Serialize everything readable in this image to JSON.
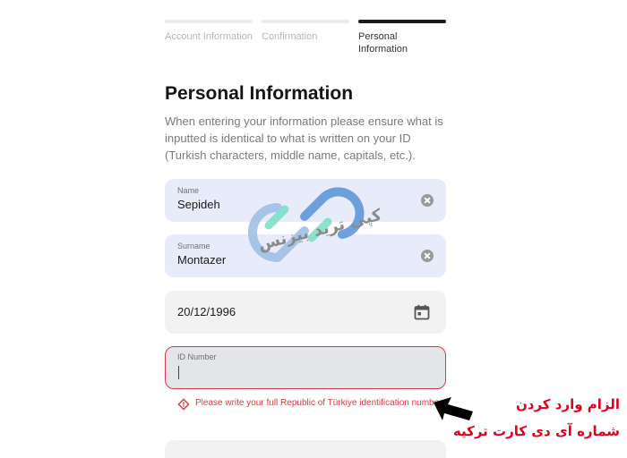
{
  "steps": [
    {
      "label": "Account Information",
      "active": false
    },
    {
      "label": "Confirmation",
      "active": false
    },
    {
      "label": "Personal Information",
      "active": true
    }
  ],
  "form": {
    "title": "Personal Information",
    "description": "When entering your information please ensure what is inputted is identical to what is written on your ID (Turkish characters, middle name, capitals, etc.).",
    "name": {
      "label": "Name",
      "value": "Sepideh"
    },
    "surname": {
      "label": "Surname",
      "value": "Montazer"
    },
    "birth_date": {
      "value": "20/12/1996"
    },
    "id_number": {
      "label": "ID Number",
      "value": ""
    },
    "error": "Please write your full Republic of Türkiye identification number."
  },
  "watermark": {
    "text": "کپی ترید بیزنس"
  },
  "annotation": {
    "line1": "الزام وارد کردن",
    "line2": "شماره آی دی کارت ترکیه"
  },
  "colors": {
    "error": "#d63b44",
    "field_bg": "#e8ecfa",
    "annotation": "#e3001b",
    "active_step": "#1a1a1a"
  },
  "icons": {
    "clear": "clear-circle-x-icon",
    "calendar": "calendar-icon",
    "error": "warning-diamond-icon",
    "arrow": "arrow-left-icon"
  }
}
